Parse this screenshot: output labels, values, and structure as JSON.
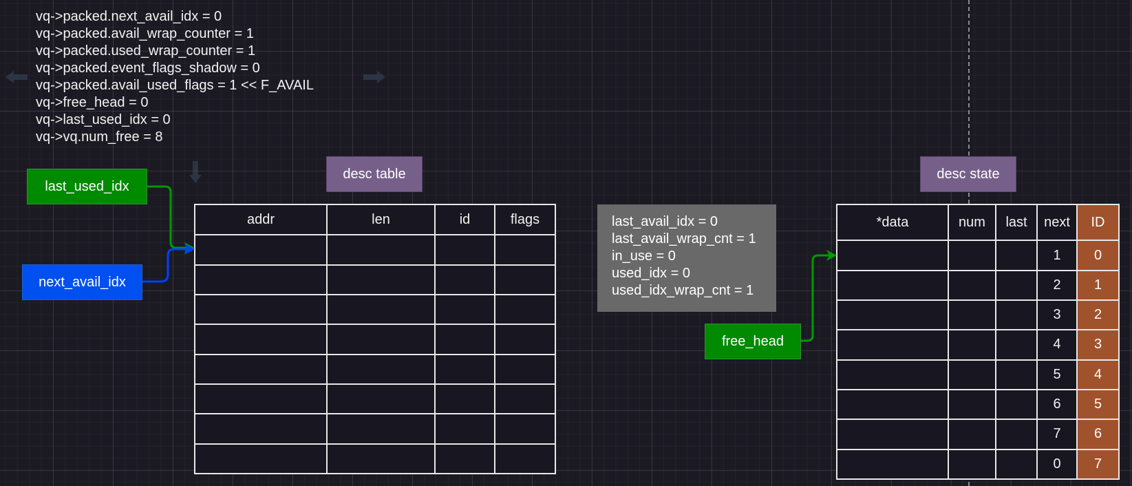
{
  "vq_fields": [
    "vq->packed.next_avail_idx = 0",
    "vq->packed.avail_wrap_counter = 1",
    "vq->packed.used_wrap_counter = 1",
    "vq->packed.event_flags_shadow = 0",
    "vq->packed.avail_used_flags = 1 << F_AVAIL",
    "vq->free_head = 0",
    "vq->last_used_idx = 0",
    "vq->vq.num_free = 8"
  ],
  "labels": {
    "last_used_idx": "last_used_idx",
    "next_avail_idx": "next_avail_idx",
    "desc_table": "desc table",
    "desc_state": "desc state",
    "free_head": "free_head"
  },
  "desc_table": {
    "columns": [
      "addr",
      "len",
      "id",
      "flags"
    ],
    "row_count": 8
  },
  "device_state": [
    "last_avail_idx = 0",
    "last_avail_wrap_cnt = 1",
    "in_use = 0",
    "used_idx = 0",
    "used_idx_wrap_cnt = 1"
  ],
  "desc_state_table": {
    "columns": [
      "*data",
      "num",
      "last",
      "next",
      "ID"
    ],
    "next": [
      "1",
      "2",
      "3",
      "4",
      "5",
      "6",
      "7",
      "0"
    ],
    "ids": [
      "0",
      "1",
      "2",
      "3",
      "4",
      "5",
      "6",
      "7"
    ]
  },
  "colors": {
    "green": "#008a00",
    "blue": "#0050ef",
    "purple": "#76608a",
    "id_column": "#a0522d",
    "state_box": "#696969"
  }
}
